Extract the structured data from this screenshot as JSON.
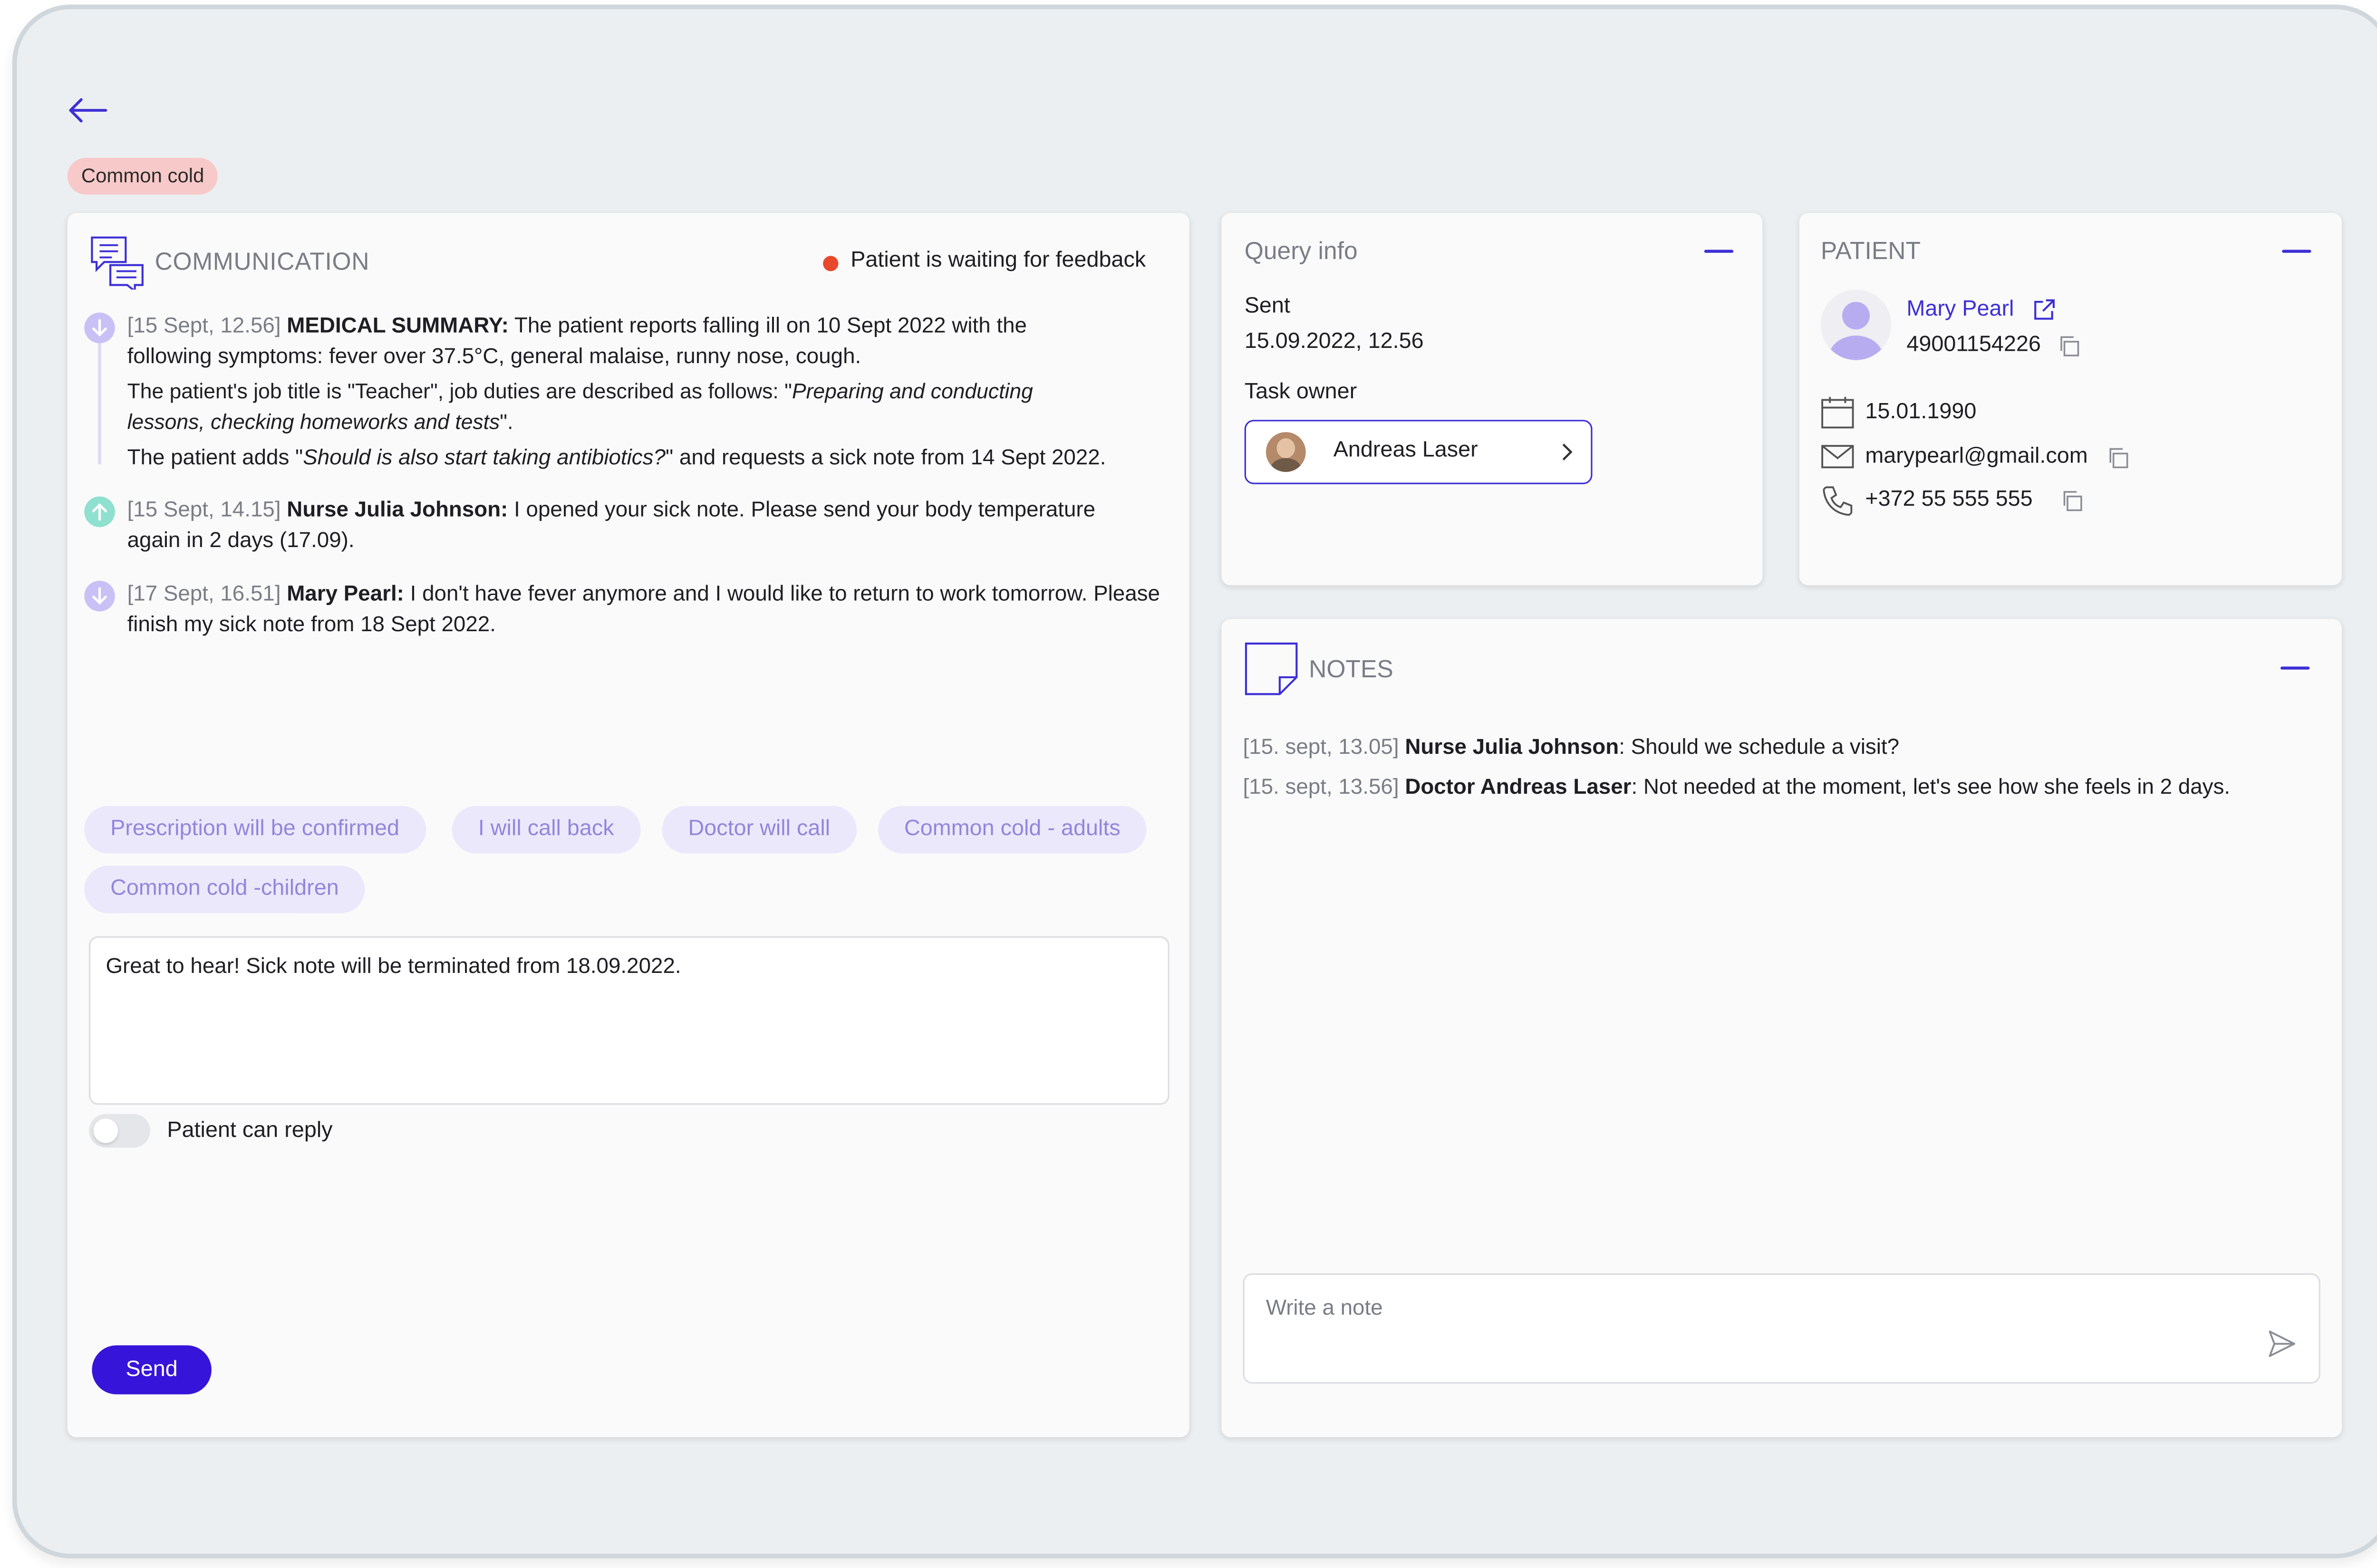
{
  "tag": "Common cold",
  "communication": {
    "title": "COMMUNICATION",
    "status": "Patient is waiting for feedback",
    "messages": [
      {
        "time": "[15 Sept, 12.56]",
        "author": "MEDICAL SUMMARY:",
        "text": "The patient reports falling ill on 10 Sept 2022 with the following symptoms: fever over 37.5°C, general malaise, runny nose, cough.",
        "para2_a": "The patient's job title is \"Teacher\", job duties are described as follows: \"",
        "para2_i": "Preparing and conducting lessons, checking homeworks and tests",
        "para2_b": "\".",
        "para3_a": "The patient adds \"",
        "para3_i": "Should is also start taking antibiotics?",
        "para3_b": "\" and requests a sick note from 14 Sept 2022."
      },
      {
        "time": "[15 Sept, 14.15]",
        "author": "Nurse Julia Johnson:",
        "text": "I opened your sick note. Please send your body temperature again in 2 days (17.09)."
      },
      {
        "time": "[17 Sept, 16.51]",
        "author": "Mary Pearl:",
        "text": "I don't have fever anymore and I would like to return to work tomorrow. Please finish my sick note from 18 Sept 2022."
      }
    ],
    "quick_replies": [
      "Prescription will be confirmed",
      "I will call back",
      "Doctor will call",
      "Common cold - adults",
      "Common cold -children"
    ],
    "reply_text": "Great to hear! Sick note will be terminated from 18.09.2022.",
    "toggle_label": "Patient can reply",
    "toggle_on": false,
    "send_label": "Send"
  },
  "query": {
    "title": "Query info",
    "sent_label": "Sent",
    "sent_value": "15.09.2022, 12.56",
    "owner_label": "Task owner",
    "owner_name": "Andreas Laser"
  },
  "patient": {
    "title": "PATIENT",
    "name": "Mary Pearl",
    "id": "49001154226",
    "dob": "15.01.1990",
    "email": "marypearl@gmail.com",
    "phone": "+372 55 555 555"
  },
  "notes": {
    "title": "NOTES",
    "items": [
      {
        "time": "[15. sept, 13.05]",
        "author": "Nurse Julia Johnson",
        "text": ": Should we schedule a visit?"
      },
      {
        "time": "[15. sept, 13.56]",
        "author": "Doctor Andreas Laser",
        "text": ": Not needed at the moment, let's see how she feels in 2 days."
      }
    ],
    "input_placeholder": "Write a note"
  },
  "colors": {
    "accent": "#3d2fd6",
    "status_dot": "#e8482b",
    "tag_bg": "#f8c9c9",
    "chip_bg": "#ece8fb",
    "incoming_icon": "#c9c0f5",
    "outgoing_icon": "#8fe0cf"
  },
  "icons": [
    "back-arrow-icon",
    "chat-bubbles-icon",
    "sticky-note-icon",
    "minimize-icon",
    "external-link-icon",
    "copy-icon",
    "calendar-icon",
    "mail-icon",
    "phone-icon",
    "chevron-right-icon",
    "send-icon",
    "arrow-down-icon",
    "arrow-up-icon",
    "user-avatar-icon"
  ]
}
